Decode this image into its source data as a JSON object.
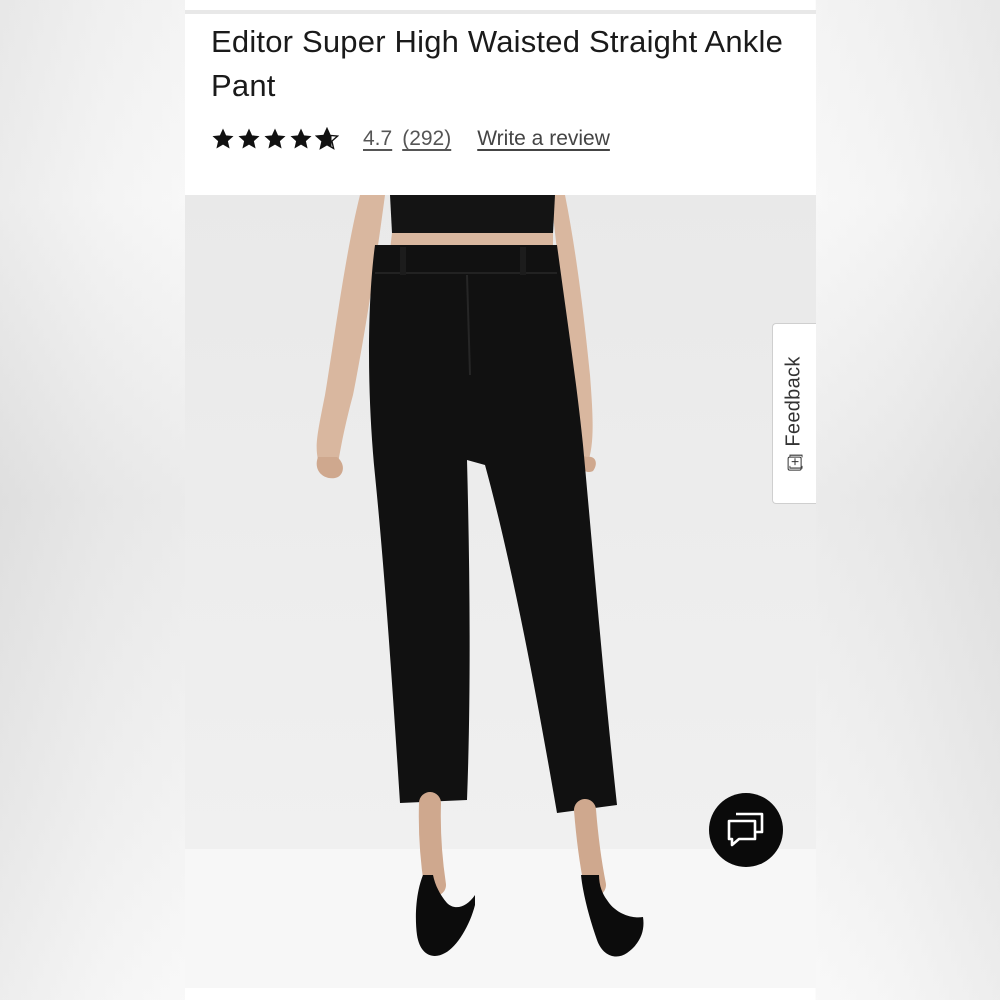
{
  "product": {
    "title": "Editor Super High Waisted Straight Ankle Pant",
    "rating_value": "4.7",
    "rating_stars": 4.7,
    "rating_max": 5,
    "review_count": "(292)",
    "write_review": "Write a review"
  },
  "image": {
    "description_icon": "product-photo"
  },
  "feedback": {
    "label": "Feedback",
    "icon": "[+]"
  },
  "chat": {
    "icon": "chat-bubbles-icon"
  },
  "colors": {
    "text": "#1a1a1a",
    "pants": "#111111",
    "chat_button": "#0a0a0a"
  }
}
